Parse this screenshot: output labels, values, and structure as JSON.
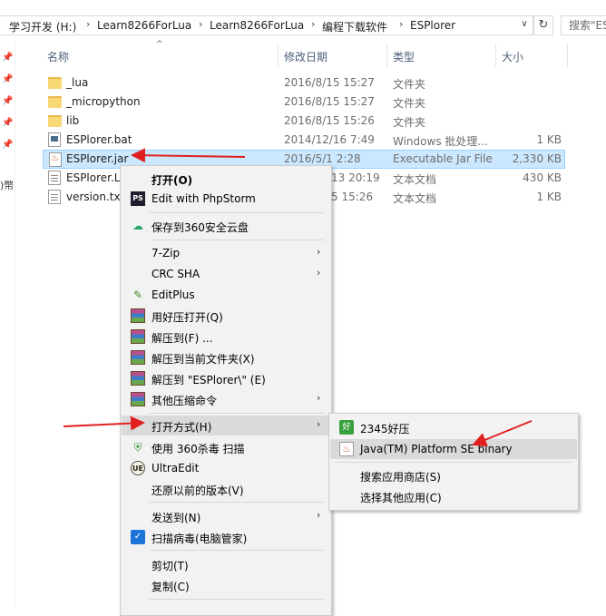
{
  "address": {
    "crumbs": [
      "学习开发 (H:)",
      "Learn8266ForLua",
      "Learn8266ForLua",
      "编程下载软件",
      "ESPlorer"
    ],
    "separator": "›",
    "dropdown": "∨",
    "refresh": "↻",
    "search_placeholder": "搜索\"ESPlorer\""
  },
  "nav": {
    "fragment": ")幣"
  },
  "columns": {
    "name": "名称",
    "date": "修改日期",
    "type": "类型",
    "size": "大小"
  },
  "files": [
    {
      "name": "_lua",
      "date": "2016/8/15 15:27",
      "type": "文件夹",
      "size": "",
      "icon": "folder-icon"
    },
    {
      "name": "_micropython",
      "date": "2016/8/15 15:27",
      "type": "文件夹",
      "size": "",
      "icon": "folder-icon"
    },
    {
      "name": "lib",
      "date": "2016/8/15 15:26",
      "type": "文件夹",
      "size": "",
      "icon": "folder-icon"
    },
    {
      "name": "ESPlorer.bat",
      "date": "2014/12/16 7:49",
      "type": "Windows 批处理...",
      "size": "1 KB",
      "icon": "batch-file-icon"
    },
    {
      "name": "ESPlorer.jar",
      "date": "2016/5/1 2:28",
      "type": "Executable Jar File",
      "size": "2,330 KB",
      "icon": "jar-file-icon"
    },
    {
      "name": "ESPlorer.L",
      "date": "13 20:19",
      "type": "文本文档",
      "size": "430 KB",
      "icon": "text-file-icon"
    },
    {
      "name": "version.txt",
      "date": "5 15:26",
      "type": "文本文档",
      "size": "1 KB",
      "icon": "text-file-icon"
    }
  ],
  "context_menu": {
    "open": "打开(O)",
    "edit_phpstorm": "Edit with PhpStorm",
    "save_360": "保存到360安全云盘",
    "zip7": "7-Zip",
    "crc": "CRC SHA",
    "editplus": "EditPlus",
    "haozip_open": "用好压打开(Q)",
    "extract_to": "解压到(F) ...",
    "extract_here": "解压到当前文件夹(X)",
    "extract_named": "解压到 \"ESPlorer\\\" (E)",
    "other_compress": "其他压缩命令",
    "open_with": "打开方式(H)",
    "scan_360": "使用 360杀毒 扫描",
    "ultraedit": "UltraEdit",
    "restore": "还原以前的版本(V)",
    "send_to": "发送到(N)",
    "scan_virus": "扫描病毒(电脑管家)",
    "cut": "剪切(T)",
    "copy": "复制(C)",
    "submenu_arrow": "›"
  },
  "open_with_menu": {
    "app_2345": "2345好压",
    "java": "Java(TM) Platform SE binary",
    "store": "搜索应用商店(S)",
    "choose": "选择其他应用(C)"
  },
  "colors": {
    "arrow": "#e02020",
    "selection": "#cce8ff",
    "menu_bg": "#f2f2f2"
  }
}
